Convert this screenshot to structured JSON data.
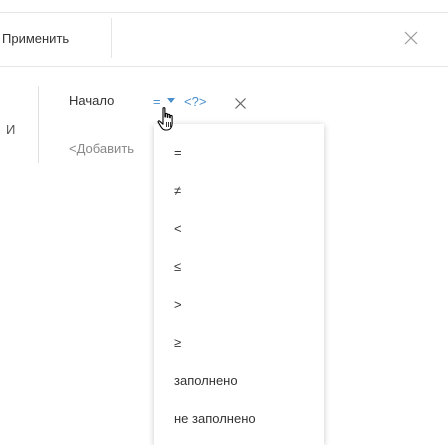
{
  "toolbar": {
    "apply_label": "Применить",
    "close_icon": "close-icon"
  },
  "filter": {
    "group_operator": "И",
    "condition": {
      "column": "Начало",
      "operator": "=",
      "value": "<?>"
    },
    "add_condition_label": "<Добавить"
  },
  "operator_menu": {
    "items": [
      "=",
      "≠",
      "<",
      "≤",
      ">",
      "≥",
      "заполнено",
      "не заполнено"
    ]
  },
  "colors": {
    "accent": "#4b8fcc",
    "text": "#333333",
    "muted": "#888888",
    "divider": "#e6e6e6"
  }
}
